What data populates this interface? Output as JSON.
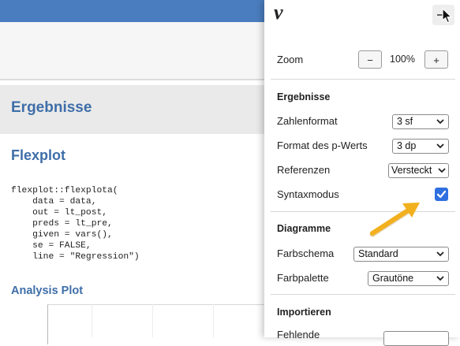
{
  "results": {
    "title": "Ergebnisse",
    "section_title": "Flexplot",
    "code": "flexplot::flexplota(\n    data = data,\n    out = lt_post,\n    preds = lt_pre,\n    given = vars(),\n    se = FALSE,\n    line = \"Regression\")",
    "plot_title": "Analysis Plot"
  },
  "panel": {
    "logo": "ν",
    "zoom": {
      "label": "Zoom",
      "minus": "−",
      "value": "100%",
      "plus": "+"
    },
    "ergebnisse": {
      "heading": "Ergebnisse",
      "zahlenformat": {
        "label": "Zahlenformat",
        "value": "3 sf"
      },
      "pformat": {
        "label": "Format des p-Werts",
        "value": "3 dp"
      },
      "referenzen": {
        "label": "Referenzen",
        "value": "Versteckt"
      },
      "syntax": {
        "label": "Syntaxmodus",
        "checked": true
      }
    },
    "diagramme": {
      "heading": "Diagramme",
      "farbschema": {
        "label": "Farbschema",
        "value": "Standard"
      },
      "farbpalette": {
        "label": "Farbpalette",
        "value": "Grautöne"
      }
    },
    "importieren": {
      "heading": "Importieren",
      "fehlende": {
        "label": "Fehlende"
      }
    }
  },
  "colors": {
    "accent_blue": "#3e6ea8",
    "topbar": "#4a7dbf",
    "checkbox": "#2f6fe0",
    "arrow": "#f2b01e"
  },
  "icons": {
    "close": "collapse-icon",
    "cursor": "mouse-pointer-icon",
    "annotation": "arrow-annotation-icon"
  }
}
